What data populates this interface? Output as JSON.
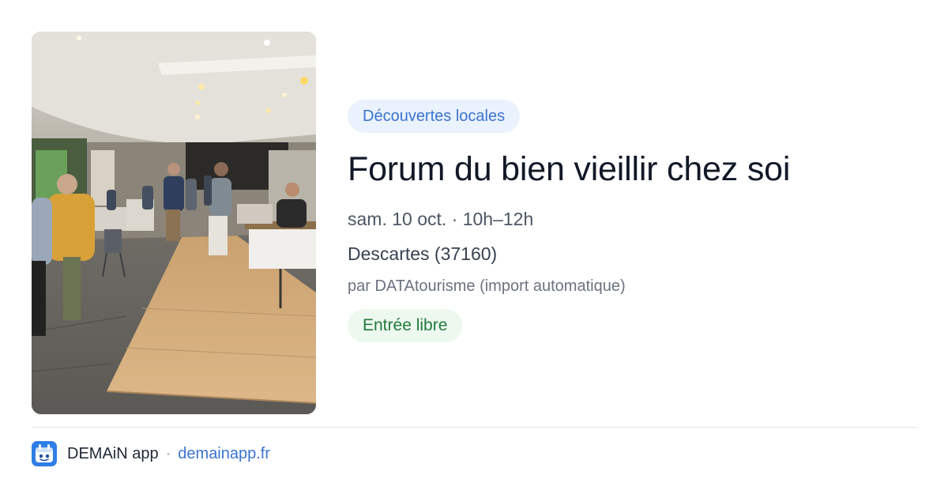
{
  "event": {
    "category": "Découvertes locales",
    "title": "Forum du bien vieillir chez soi",
    "datetime": "sam. 10 oct. · 10h–12h",
    "location": "Descartes (37160)",
    "organizer": "par DATAtourisme (import automatique)",
    "price": "Entrée libre"
  },
  "footer": {
    "app_name": "DEMAiN app",
    "separator": "·",
    "site": "demainapp.fr"
  },
  "icons": {
    "app_logo": "demain-app-logo-icon"
  },
  "colors": {
    "category_text": "#3b74d1",
    "category_bg": "#eaf2fd",
    "price_text": "#217a3d",
    "price_bg": "#edf8ef",
    "link": "#3b74d1"
  }
}
